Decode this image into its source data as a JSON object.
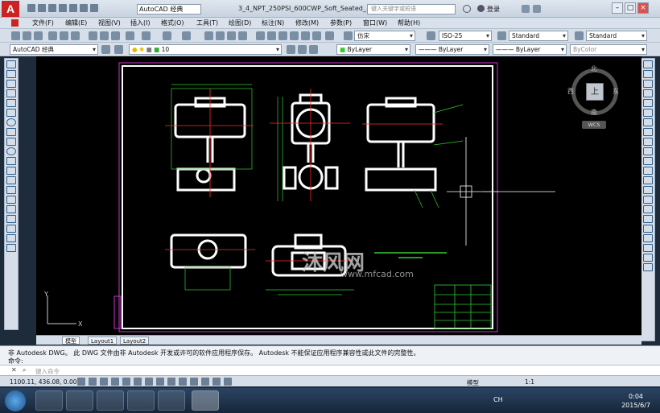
{
  "titlebar": {
    "logo": "A",
    "workspace": "AutoCAD 经典",
    "doc_title": "3_4_NPT_250PSI_600CWP_Soft_Seated_...",
    "search_placeholder": "键入关键字或短语",
    "login": "登录"
  },
  "menu": [
    "文件(F)",
    "编辑(E)",
    "视图(V)",
    "插入(I)",
    "格式(O)",
    "工具(T)",
    "绘图(D)",
    "标注(N)",
    "修改(M)",
    "参数(P)",
    "窗口(W)",
    "帮助(H)"
  ],
  "toolbar1": {
    "text_style": "仿宋",
    "dim_style": "ISO-25",
    "table_style": "Standard",
    "mleader_style": "Standard"
  },
  "toolbar2": {
    "workspace": "AutoCAD 经典",
    "layer": "10",
    "color": "ByLayer",
    "linetype": "ByLayer",
    "lineweight": "ByLayer",
    "plotstyle": "ByColor"
  },
  "viewcube": {
    "north": "北",
    "south": "南",
    "east": "东",
    "west": "西",
    "top": "上",
    "wcs": "WCS"
  },
  "layout_tabs": [
    "模型",
    "Layout1",
    "Layout2"
  ],
  "cmdline": {
    "line1": "非 Autodesk DWG。  此 DWG 文件由非 Autodesk 开发或许可的软件应用程序保存。  Autodesk 不能保证应用程序兼容性或此文件的完整性。",
    "line2": "命令:",
    "placeholder": "键入命令"
  },
  "status": {
    "coords": "1100.11, 436.08, 0.00",
    "model": "模型",
    "scale": "1:1"
  },
  "watermark": {
    "main": "沐风网",
    "sub": "www.mfcad.com"
  },
  "taskbar": {
    "time": "0:04",
    "date": "2015/6/7",
    "lang": "CH"
  },
  "colors": {
    "canvas": "#000000",
    "sheet_border": "#ffffff",
    "center_lines": "#ff2a2a",
    "dimensions": "#33cc33",
    "frame": "#cc33cc"
  }
}
